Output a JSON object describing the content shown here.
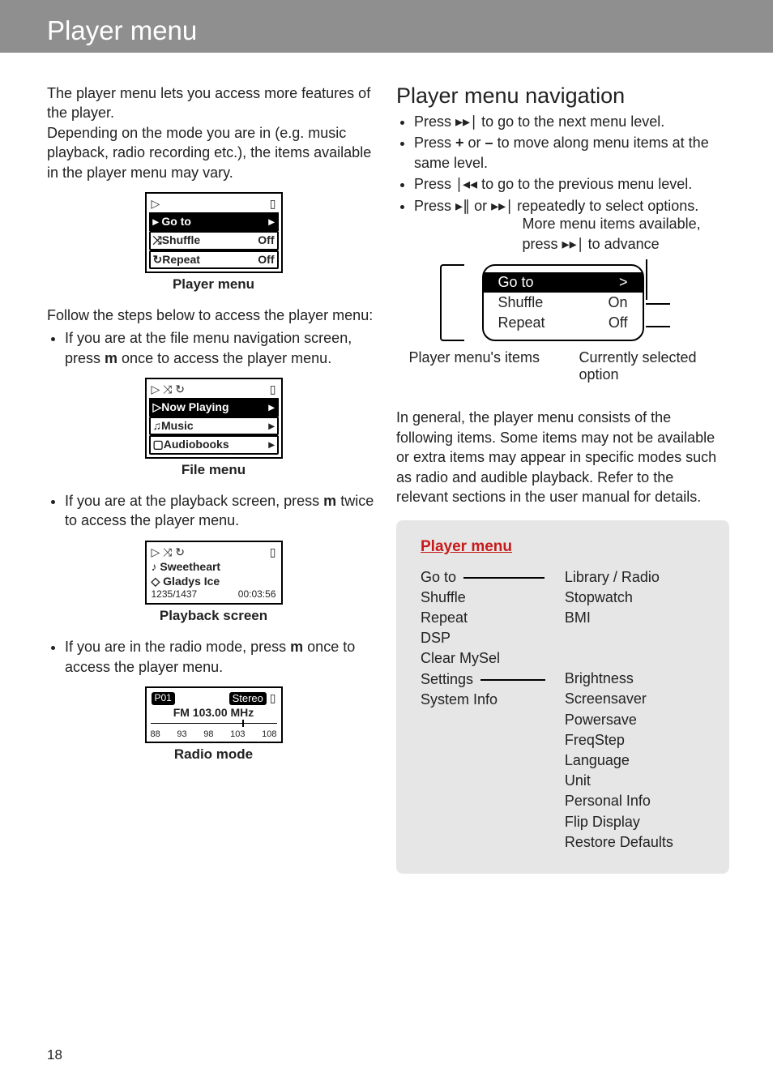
{
  "title": "Player menu",
  "page_number": "18",
  "left": {
    "intro1": "The player menu lets you access more features of the player.",
    "intro2": "Depending on the mode you are in (e.g. music playback, radio recording etc.), the items available in the player menu may vary.",
    "device_playermenu": {
      "caption": "Player menu",
      "rows": [
        {
          "label": "Go to",
          "value": ""
        },
        {
          "label": "Shuffle",
          "value": "Off"
        },
        {
          "label": "Repeat",
          "value": "Off"
        }
      ]
    },
    "follow": "Follow the steps below to access the player menu:",
    "step1_a": "If you are at the file menu navigation screen, press ",
    "key_m": "m",
    "step1_b": " once to access the player menu.",
    "device_filemenu": {
      "caption": "File menu",
      "rows": [
        {
          "label": "Now Playing",
          "value": ""
        },
        {
          "label": "Music",
          "value": ""
        },
        {
          "label": "Audiobooks",
          "value": ""
        }
      ]
    },
    "step2_a": "If you are at the playback screen, press ",
    "step2_b": " twice to access the player menu.",
    "device_playback": {
      "caption": "Playback screen",
      "title": "Sweetheart",
      "artist": "Gladys Ice",
      "counter": "1235/1437",
      "time": "00:03:56"
    },
    "step3_a": "If you are in the radio mode, press ",
    "step3_b": " once to access the player menu.",
    "device_radio": {
      "caption": "Radio mode",
      "preset": "P01",
      "stereo": "Stereo",
      "freq": "FM 103.00 MHz",
      "ticks": [
        "88",
        "93",
        "98",
        "103",
        "108"
      ]
    }
  },
  "right": {
    "heading": "Player menu navigation",
    "bullets": [
      {
        "a": "Press ",
        "icon": "fwd-icon",
        "b": " to go to the next menu level."
      },
      {
        "a": "Press ",
        "k1": "+",
        "mid": " or ",
        "k2": "–",
        "b": " to move along menu items at the same level."
      },
      {
        "a": "Press ",
        "icon": "rew-icon",
        "b": " to go to the previous menu level."
      },
      {
        "a": "Press ",
        "icon": "playpause-icon",
        "mid": " or ",
        "icon2": "fwd-icon",
        "b": " repeatedly to select options."
      }
    ],
    "diag": {
      "hint_top_a": "More menu items available, press ",
      "hint_top_b": " to advance",
      "rows": [
        {
          "label": "Go to",
          "value": ">"
        },
        {
          "label": "Shuffle",
          "value": "On"
        },
        {
          "label": "Repeat",
          "value": "Off"
        }
      ],
      "label_left": "Player menu's items",
      "label_right": "Currently selected option"
    },
    "para": "In general, the player menu consists of the following items. Some items may not be available or extra items may appear in specific modes such as radio and audible playback. Refer to the relevant sections in the user manual for details.",
    "panel": {
      "title": "Player menu",
      "left_items": [
        "Go to",
        "Shuffle",
        "Repeat",
        "DSP",
        "Clear MySel",
        "Settings",
        "System Info"
      ],
      "goto_sub": [
        "Library / Radio",
        "Stopwatch",
        "BMI"
      ],
      "settings_sub": [
        "Brightness",
        "Screensaver",
        "Powersave",
        "FreqStep",
        "Language",
        "Unit",
        "Personal Info",
        "Flip Display",
        "Restore Defaults"
      ]
    }
  },
  "glyphs": {
    "fwd": "▸▸∣",
    "rew": "∣◂◂",
    "playpause": "▸∥",
    "chevron": "▸",
    "play": "▷",
    "shuffle": "⤨",
    "repeat": "↻",
    "battery": "▯",
    "note": "♪",
    "headphones": "♫",
    "book": "▢",
    "person": "◇"
  }
}
